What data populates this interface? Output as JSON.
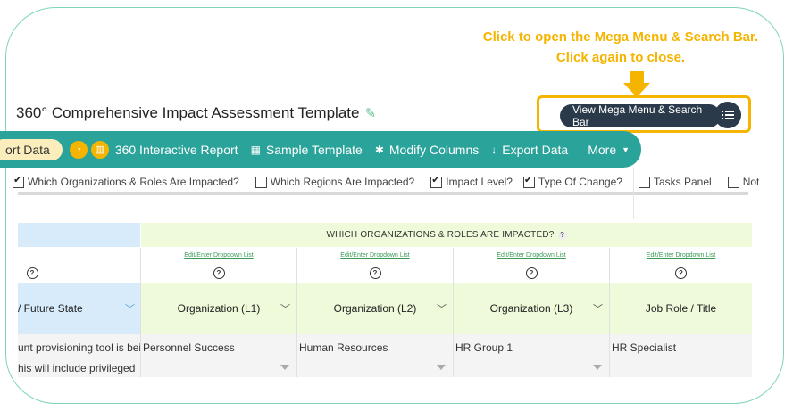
{
  "callout": {
    "line1": "Click to open the Mega Menu & Search Bar.",
    "line2": "Click again to close."
  },
  "mega_button": {
    "label": "View Mega Menu & Search Bar",
    "icon": "list-icon"
  },
  "title": "360° Comprehensive Impact Assessment Template",
  "toolbar": {
    "export_pill": "ort Data",
    "report": "360 Interactive Report",
    "sample": "Sample Template",
    "modify": "Modify Columns",
    "export": "Export Data",
    "more": "More"
  },
  "checks": [
    {
      "label": "Which Organizations & Roles Are Impacted?",
      "checked": true
    },
    {
      "label": "Which Regions Are Impacted?",
      "checked": false
    },
    {
      "label": "Impact Level?",
      "checked": true
    },
    {
      "label": "Type Of Change?",
      "checked": true
    },
    {
      "label": "Tasks Panel",
      "checked": false
    },
    {
      "label": "Not",
      "checked": false
    }
  ],
  "grid": {
    "group_header": "WHICH ORGANIZATIONS & ROLES ARE IMPACTED?",
    "link_text": "Edit/Enter Dropdown List",
    "columns": [
      {
        "label": "/ Future State"
      },
      {
        "label": "Organization (L1)"
      },
      {
        "label": "Organization (L2)"
      },
      {
        "label": "Organization (L3)"
      },
      {
        "label": "Job Role / Title"
      }
    ],
    "row": {
      "left_line1": "unt provisioning tool is bei",
      "left_line2": "his will include privileged",
      "cells": [
        "Personnel Success",
        "Human Resources",
        "HR Group 1",
        "HR Specialist"
      ]
    }
  },
  "colors": {
    "accent_teal": "#2aa39a",
    "highlight": "#f5b400",
    "dark_button": "#2b3a4a"
  }
}
